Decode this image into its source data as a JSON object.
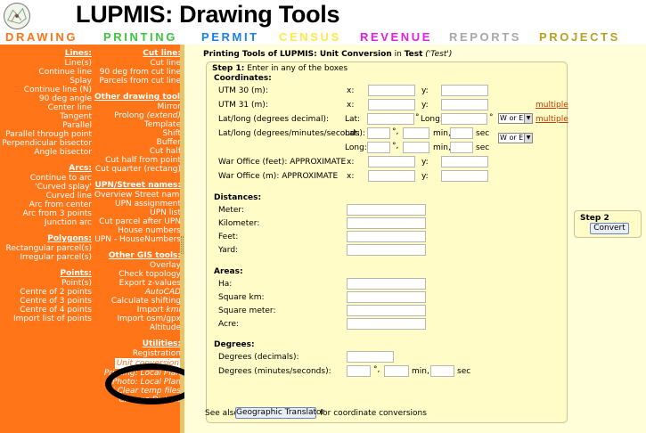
{
  "header": {
    "title": "LUPMIS: Drawing Tools",
    "menu": [
      {
        "label": "DRAWING",
        "color": "#ff7518"
      },
      {
        "label": "PRINTING",
        "color": "#3ec43e"
      },
      {
        "label": "PERMIT",
        "color": "#1a80e6"
      },
      {
        "label": "CENSUS",
        "color": "#ffe84a"
      },
      {
        "label": "REVENUE",
        "color": "#e020e0"
      },
      {
        "label": "REPORTS",
        "color": "#a8a8a8"
      },
      {
        "label": "PROJECTS",
        "color": "#b8a020"
      }
    ]
  },
  "left": {
    "col_a": [
      {
        "title": "Lines:",
        "items": [
          "Line(s)",
          "Continue line",
          "Splay",
          "Continue line (N)",
          "90 deg angle",
          "Center line",
          "Tangent",
          "Parallel",
          "Parallel through point",
          "Perpendicular bisector",
          "Angle bisector"
        ]
      },
      {
        "title": "Arcs:",
        "items": [
          "Continue to arc",
          "'Curved splay'",
          "Curved line",
          "Arc from center",
          "Arc from 3 points",
          "Junction arc"
        ]
      },
      {
        "title": "Polygons:",
        "items": [
          "Rectangular parcel(s)",
          "Irregular parcel(s)"
        ]
      },
      {
        "title": "Points:",
        "items": [
          "Point(s)",
          "Centre of 2 points",
          "Centre of 3 points",
          "Centre of 4 points",
          "Import list of points"
        ]
      }
    ],
    "col_b_cut": {
      "title": "Cut line:",
      "items": [
        "Cut line",
        "90 deg from cut line",
        "Parcels from cut line"
      ]
    },
    "col_b_other_drawing": {
      "title": "Other drawing tools:",
      "items": [
        "Mirror",
        "Prolong",
        "Template",
        "Shift",
        "Buffer",
        "Cut half",
        "Cut half from point",
        "Cut quarter (rectang)"
      ],
      "prolong_suffix": "(extend)"
    },
    "col_b_upn": {
      "title": "UPN/Street names:",
      "items": [
        "Overview Street name",
        "UPN assignment",
        "UPN list",
        "Cut parcel after UPN",
        "House numbers",
        "UPN - HouseNumbers"
      ]
    },
    "col_b_gis": {
      "title": "Other GIS tools:",
      "items": [
        "Overlay",
        "Check topology",
        "Export z-values",
        "AutoCAD",
        "Calculate shifting",
        "Import kml",
        "Import osm/gpx",
        "Altitude"
      ],
      "import_prefix": "Import"
    },
    "col_b_utilities": {
      "title": "Utilities:",
      "items": [
        "Registration",
        "Unit conversion",
        "Printing: Local Plan",
        "Photo: Local Plan",
        "i   Clear temp files",
        "Change District"
      ]
    }
  },
  "main": {
    "title_prefix": "Printing Tools of LUPMIS: Unit Conversion",
    "title_in": "in",
    "title_place": "Test",
    "title_quoted": "('Test')",
    "step1_label": "Step 1:",
    "step1_text": "Enter in any of the boxes",
    "coordinates_header": "Coordinates:",
    "utm30": "UTM 30 (m):",
    "utm31": "UTM 31 (m):",
    "latlong_dec": "Lat/long (degrees decimal):",
    "latlong_dms": "Lat/long (degrees/minutes/seconds):",
    "war_ft": "War Office (feet): APPROXIMATE",
    "war_m": "War Office (m): APPROXIMATE",
    "x": "x:",
    "y": "y:",
    "lat": "Lat:",
    "long": "Long:",
    "lat_sfx": "°",
    "long_sfx": "°",
    "deg": "°,",
    "min": "min,",
    "sec": "sec",
    "dropdown_value": "W or E",
    "multiple": "multiple",
    "distances_header": "Distances:",
    "distances": [
      "Meter:",
      "Kilometer:",
      "Feet:",
      "Yard:"
    ],
    "areas_header": "Areas:",
    "areas": [
      "Ha:",
      "Square km:",
      "Square meter:",
      "Acre:"
    ],
    "degrees_header": "Degrees:",
    "degrees_decimals": "Degrees (decimals):",
    "degrees_dms": "Degrees (minutes/seconds):",
    "step2_label": "Step 2",
    "convert_button": "Convert",
    "see_also_prefix": "See also",
    "geo_button": "Geographic Translator",
    "see_also_suffix": "for coordinate conversions"
  }
}
